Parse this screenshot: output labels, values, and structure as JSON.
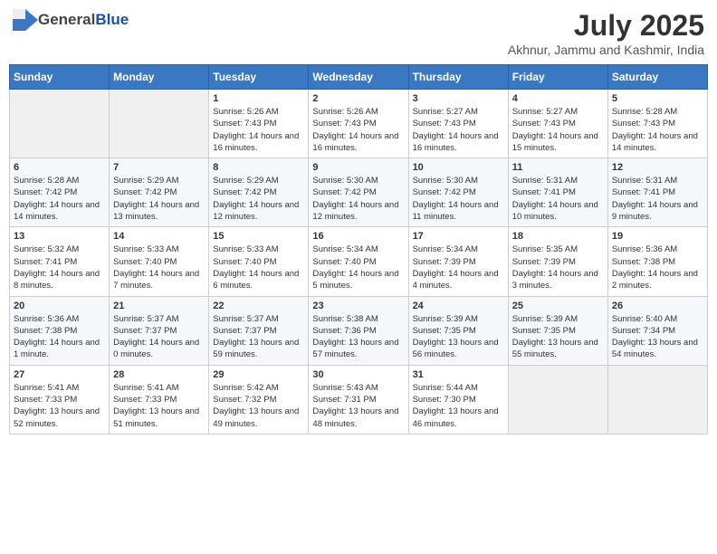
{
  "header": {
    "logo_general": "General",
    "logo_blue": "Blue",
    "month_year": "July 2025",
    "location": "Akhnur, Jammu and Kashmir, India"
  },
  "weekdays": [
    "Sunday",
    "Monday",
    "Tuesday",
    "Wednesday",
    "Thursday",
    "Friday",
    "Saturday"
  ],
  "weeks": [
    [
      {
        "day": "",
        "info": ""
      },
      {
        "day": "",
        "info": ""
      },
      {
        "day": "1",
        "info": "Sunrise: 5:26 AM\nSunset: 7:43 PM\nDaylight: 14 hours and 16 minutes."
      },
      {
        "day": "2",
        "info": "Sunrise: 5:26 AM\nSunset: 7:43 PM\nDaylight: 14 hours and 16 minutes."
      },
      {
        "day": "3",
        "info": "Sunrise: 5:27 AM\nSunset: 7:43 PM\nDaylight: 14 hours and 16 minutes."
      },
      {
        "day": "4",
        "info": "Sunrise: 5:27 AM\nSunset: 7:43 PM\nDaylight: 14 hours and 15 minutes."
      },
      {
        "day": "5",
        "info": "Sunrise: 5:28 AM\nSunset: 7:43 PM\nDaylight: 14 hours and 14 minutes."
      }
    ],
    [
      {
        "day": "6",
        "info": "Sunrise: 5:28 AM\nSunset: 7:42 PM\nDaylight: 14 hours and 14 minutes."
      },
      {
        "day": "7",
        "info": "Sunrise: 5:29 AM\nSunset: 7:42 PM\nDaylight: 14 hours and 13 minutes."
      },
      {
        "day": "8",
        "info": "Sunrise: 5:29 AM\nSunset: 7:42 PM\nDaylight: 14 hours and 12 minutes."
      },
      {
        "day": "9",
        "info": "Sunrise: 5:30 AM\nSunset: 7:42 PM\nDaylight: 14 hours and 12 minutes."
      },
      {
        "day": "10",
        "info": "Sunrise: 5:30 AM\nSunset: 7:42 PM\nDaylight: 14 hours and 11 minutes."
      },
      {
        "day": "11",
        "info": "Sunrise: 5:31 AM\nSunset: 7:41 PM\nDaylight: 14 hours and 10 minutes."
      },
      {
        "day": "12",
        "info": "Sunrise: 5:31 AM\nSunset: 7:41 PM\nDaylight: 14 hours and 9 minutes."
      }
    ],
    [
      {
        "day": "13",
        "info": "Sunrise: 5:32 AM\nSunset: 7:41 PM\nDaylight: 14 hours and 8 minutes."
      },
      {
        "day": "14",
        "info": "Sunrise: 5:33 AM\nSunset: 7:40 PM\nDaylight: 14 hours and 7 minutes."
      },
      {
        "day": "15",
        "info": "Sunrise: 5:33 AM\nSunset: 7:40 PM\nDaylight: 14 hours and 6 minutes."
      },
      {
        "day": "16",
        "info": "Sunrise: 5:34 AM\nSunset: 7:40 PM\nDaylight: 14 hours and 5 minutes."
      },
      {
        "day": "17",
        "info": "Sunrise: 5:34 AM\nSunset: 7:39 PM\nDaylight: 14 hours and 4 minutes."
      },
      {
        "day": "18",
        "info": "Sunrise: 5:35 AM\nSunset: 7:39 PM\nDaylight: 14 hours and 3 minutes."
      },
      {
        "day": "19",
        "info": "Sunrise: 5:36 AM\nSunset: 7:38 PM\nDaylight: 14 hours and 2 minutes."
      }
    ],
    [
      {
        "day": "20",
        "info": "Sunrise: 5:36 AM\nSunset: 7:38 PM\nDaylight: 14 hours and 1 minute."
      },
      {
        "day": "21",
        "info": "Sunrise: 5:37 AM\nSunset: 7:37 PM\nDaylight: 14 hours and 0 minutes."
      },
      {
        "day": "22",
        "info": "Sunrise: 5:37 AM\nSunset: 7:37 PM\nDaylight: 13 hours and 59 minutes."
      },
      {
        "day": "23",
        "info": "Sunrise: 5:38 AM\nSunset: 7:36 PM\nDaylight: 13 hours and 57 minutes."
      },
      {
        "day": "24",
        "info": "Sunrise: 5:39 AM\nSunset: 7:35 PM\nDaylight: 13 hours and 56 minutes."
      },
      {
        "day": "25",
        "info": "Sunrise: 5:39 AM\nSunset: 7:35 PM\nDaylight: 13 hours and 55 minutes."
      },
      {
        "day": "26",
        "info": "Sunrise: 5:40 AM\nSunset: 7:34 PM\nDaylight: 13 hours and 54 minutes."
      }
    ],
    [
      {
        "day": "27",
        "info": "Sunrise: 5:41 AM\nSunset: 7:33 PM\nDaylight: 13 hours and 52 minutes."
      },
      {
        "day": "28",
        "info": "Sunrise: 5:41 AM\nSunset: 7:33 PM\nDaylight: 13 hours and 51 minutes."
      },
      {
        "day": "29",
        "info": "Sunrise: 5:42 AM\nSunset: 7:32 PM\nDaylight: 13 hours and 49 minutes."
      },
      {
        "day": "30",
        "info": "Sunrise: 5:43 AM\nSunset: 7:31 PM\nDaylight: 13 hours and 48 minutes."
      },
      {
        "day": "31",
        "info": "Sunrise: 5:44 AM\nSunset: 7:30 PM\nDaylight: 13 hours and 46 minutes."
      },
      {
        "day": "",
        "info": ""
      },
      {
        "day": "",
        "info": ""
      }
    ]
  ]
}
